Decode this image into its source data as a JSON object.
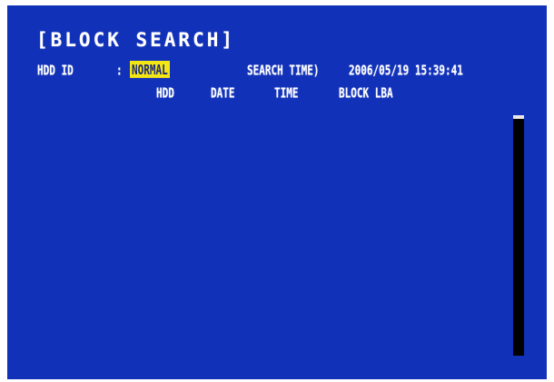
{
  "screen": {
    "title": "[BLOCK SEARCH]",
    "hdd_id": {
      "label": "HDD ID",
      "separator": ":",
      "value": "NORMAL"
    },
    "search_time": {
      "label": "SEARCH TIME)",
      "value": "2006/05/19 15:39:41"
    },
    "columns": [
      "HDD",
      "DATE",
      "TIME",
      "BLOCK LBA"
    ],
    "rows": []
  },
  "colors": {
    "background": "#1131b8",
    "text": "#ffffff",
    "highlight": "#f4e514",
    "scrollbar": "#000000"
  }
}
